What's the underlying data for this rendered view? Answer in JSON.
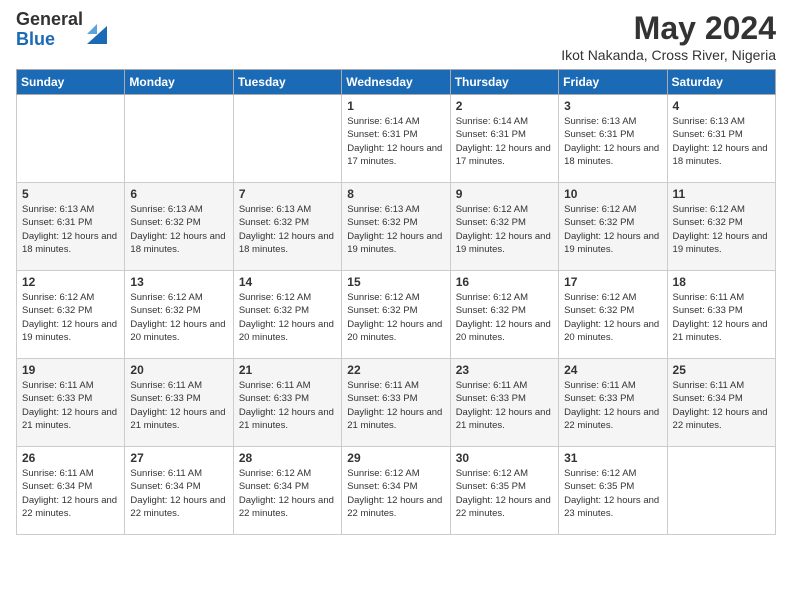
{
  "logo": {
    "general": "General",
    "blue": "Blue"
  },
  "title": "May 2024",
  "location": "Ikot Nakanda, Cross River, Nigeria",
  "days_of_week": [
    "Sunday",
    "Monday",
    "Tuesday",
    "Wednesday",
    "Thursday",
    "Friday",
    "Saturday"
  ],
  "weeks": [
    [
      {
        "day": "",
        "sunrise": "",
        "sunset": "",
        "daylight": ""
      },
      {
        "day": "",
        "sunrise": "",
        "sunset": "",
        "daylight": ""
      },
      {
        "day": "",
        "sunrise": "",
        "sunset": "",
        "daylight": ""
      },
      {
        "day": "1",
        "sunrise": "Sunrise: 6:14 AM",
        "sunset": "Sunset: 6:31 PM",
        "daylight": "Daylight: 12 hours and 17 minutes."
      },
      {
        "day": "2",
        "sunrise": "Sunrise: 6:14 AM",
        "sunset": "Sunset: 6:31 PM",
        "daylight": "Daylight: 12 hours and 17 minutes."
      },
      {
        "day": "3",
        "sunrise": "Sunrise: 6:13 AM",
        "sunset": "Sunset: 6:31 PM",
        "daylight": "Daylight: 12 hours and 18 minutes."
      },
      {
        "day": "4",
        "sunrise": "Sunrise: 6:13 AM",
        "sunset": "Sunset: 6:31 PM",
        "daylight": "Daylight: 12 hours and 18 minutes."
      }
    ],
    [
      {
        "day": "5",
        "sunrise": "Sunrise: 6:13 AM",
        "sunset": "Sunset: 6:31 PM",
        "daylight": "Daylight: 12 hours and 18 minutes."
      },
      {
        "day": "6",
        "sunrise": "Sunrise: 6:13 AM",
        "sunset": "Sunset: 6:32 PM",
        "daylight": "Daylight: 12 hours and 18 minutes."
      },
      {
        "day": "7",
        "sunrise": "Sunrise: 6:13 AM",
        "sunset": "Sunset: 6:32 PM",
        "daylight": "Daylight: 12 hours and 18 minutes."
      },
      {
        "day": "8",
        "sunrise": "Sunrise: 6:13 AM",
        "sunset": "Sunset: 6:32 PM",
        "daylight": "Daylight: 12 hours and 19 minutes."
      },
      {
        "day": "9",
        "sunrise": "Sunrise: 6:12 AM",
        "sunset": "Sunset: 6:32 PM",
        "daylight": "Daylight: 12 hours and 19 minutes."
      },
      {
        "day": "10",
        "sunrise": "Sunrise: 6:12 AM",
        "sunset": "Sunset: 6:32 PM",
        "daylight": "Daylight: 12 hours and 19 minutes."
      },
      {
        "day": "11",
        "sunrise": "Sunrise: 6:12 AM",
        "sunset": "Sunset: 6:32 PM",
        "daylight": "Daylight: 12 hours and 19 minutes."
      }
    ],
    [
      {
        "day": "12",
        "sunrise": "Sunrise: 6:12 AM",
        "sunset": "Sunset: 6:32 PM",
        "daylight": "Daylight: 12 hours and 19 minutes."
      },
      {
        "day": "13",
        "sunrise": "Sunrise: 6:12 AM",
        "sunset": "Sunset: 6:32 PM",
        "daylight": "Daylight: 12 hours and 20 minutes."
      },
      {
        "day": "14",
        "sunrise": "Sunrise: 6:12 AM",
        "sunset": "Sunset: 6:32 PM",
        "daylight": "Daylight: 12 hours and 20 minutes."
      },
      {
        "day": "15",
        "sunrise": "Sunrise: 6:12 AM",
        "sunset": "Sunset: 6:32 PM",
        "daylight": "Daylight: 12 hours and 20 minutes."
      },
      {
        "day": "16",
        "sunrise": "Sunrise: 6:12 AM",
        "sunset": "Sunset: 6:32 PM",
        "daylight": "Daylight: 12 hours and 20 minutes."
      },
      {
        "day": "17",
        "sunrise": "Sunrise: 6:12 AM",
        "sunset": "Sunset: 6:32 PM",
        "daylight": "Daylight: 12 hours and 20 minutes."
      },
      {
        "day": "18",
        "sunrise": "Sunrise: 6:11 AM",
        "sunset": "Sunset: 6:33 PM",
        "daylight": "Daylight: 12 hours and 21 minutes."
      }
    ],
    [
      {
        "day": "19",
        "sunrise": "Sunrise: 6:11 AM",
        "sunset": "Sunset: 6:33 PM",
        "daylight": "Daylight: 12 hours and 21 minutes."
      },
      {
        "day": "20",
        "sunrise": "Sunrise: 6:11 AM",
        "sunset": "Sunset: 6:33 PM",
        "daylight": "Daylight: 12 hours and 21 minutes."
      },
      {
        "day": "21",
        "sunrise": "Sunrise: 6:11 AM",
        "sunset": "Sunset: 6:33 PM",
        "daylight": "Daylight: 12 hours and 21 minutes."
      },
      {
        "day": "22",
        "sunrise": "Sunrise: 6:11 AM",
        "sunset": "Sunset: 6:33 PM",
        "daylight": "Daylight: 12 hours and 21 minutes."
      },
      {
        "day": "23",
        "sunrise": "Sunrise: 6:11 AM",
        "sunset": "Sunset: 6:33 PM",
        "daylight": "Daylight: 12 hours and 21 minutes."
      },
      {
        "day": "24",
        "sunrise": "Sunrise: 6:11 AM",
        "sunset": "Sunset: 6:33 PM",
        "daylight": "Daylight: 12 hours and 22 minutes."
      },
      {
        "day": "25",
        "sunrise": "Sunrise: 6:11 AM",
        "sunset": "Sunset: 6:34 PM",
        "daylight": "Daylight: 12 hours and 22 minutes."
      }
    ],
    [
      {
        "day": "26",
        "sunrise": "Sunrise: 6:11 AM",
        "sunset": "Sunset: 6:34 PM",
        "daylight": "Daylight: 12 hours and 22 minutes."
      },
      {
        "day": "27",
        "sunrise": "Sunrise: 6:11 AM",
        "sunset": "Sunset: 6:34 PM",
        "daylight": "Daylight: 12 hours and 22 minutes."
      },
      {
        "day": "28",
        "sunrise": "Sunrise: 6:12 AM",
        "sunset": "Sunset: 6:34 PM",
        "daylight": "Daylight: 12 hours and 22 minutes."
      },
      {
        "day": "29",
        "sunrise": "Sunrise: 6:12 AM",
        "sunset": "Sunset: 6:34 PM",
        "daylight": "Daylight: 12 hours and 22 minutes."
      },
      {
        "day": "30",
        "sunrise": "Sunrise: 6:12 AM",
        "sunset": "Sunset: 6:35 PM",
        "daylight": "Daylight: 12 hours and 22 minutes."
      },
      {
        "day": "31",
        "sunrise": "Sunrise: 6:12 AM",
        "sunset": "Sunset: 6:35 PM",
        "daylight": "Daylight: 12 hours and 23 minutes."
      },
      {
        "day": "",
        "sunrise": "",
        "sunset": "",
        "daylight": ""
      }
    ]
  ],
  "accent_color": "#1a6ab5"
}
